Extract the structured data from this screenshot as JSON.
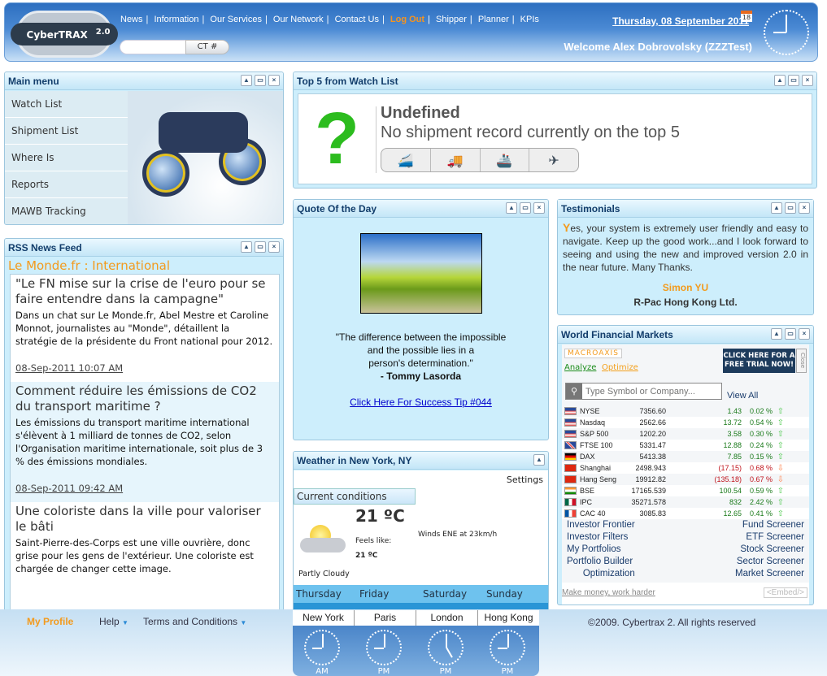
{
  "header": {
    "logo": "CyberTRAX",
    "logo_version": "2.0",
    "nav": [
      "News",
      "Information",
      "Our Services",
      "Our Network",
      "Contact Us",
      "Log Out",
      "Shipper",
      "Planner",
      "KPIs"
    ],
    "ct_button": "CT #",
    "ct_value": "",
    "date": "Thursday, 08 September 2011",
    "calendar_day": "18",
    "welcome": "Welcome Alex Dobrovolsky (ZZZTest)"
  },
  "main_menu": {
    "title": "Main menu",
    "items": [
      "Watch List",
      "Shipment List",
      "Where Is",
      "Reports",
      "MAWB Tracking"
    ]
  },
  "rss": {
    "title": "RSS News Feed",
    "source": "Le Monde.fr : International",
    "items": [
      {
        "title": "\"Le FN mise sur la crise de l'euro pour se faire entendre dans la campagne\"",
        "desc": "Dans un chat sur Le Monde.fr, Abel Mestre et Caroline Monnot, journalistes au \"Monde\", détaillent la stratégie de la présidente du Front national pour 2012.",
        "date": "08-Sep-2011 10:07 AM"
      },
      {
        "title": "Comment réduire les émissions de CO2 du transport maritime ?",
        "desc": "Les émissions du transport maritime international s'élèvent à 1 milliard de tonnes de CO2, selon l'Organisation maritime internationale, soit plus de 3 % des émissions mondiales.",
        "date": "08-Sep-2011 09:42 AM"
      },
      {
        "title": "Une coloriste dans la ville pour valoriser le bâti",
        "desc": "Saint-Pierre-des-Corps est une ville ouvrière, donc grise pour les gens de l'extérieur. Une coloriste est chargée de changer cette image.",
        "date": ""
      }
    ]
  },
  "top5": {
    "title": "Top 5 from Watch List",
    "status": "Undefined",
    "message": "No shipment record currently on the top 5",
    "modes": [
      "rail-icon",
      "truck-icon",
      "ship-icon",
      "plane-icon"
    ]
  },
  "quote": {
    "title": "Quote Of the Day",
    "lines": [
      "\"The difference between the impossible",
      "and the possible lies in a",
      "person's determination.\""
    ],
    "author": "- Tommy Lasorda",
    "link": "Click Here For Success Tip #044"
  },
  "testimonials": {
    "title": "Testimonials",
    "first_letter": "Y",
    "text": "es, your system is extremely user friendly and easy to navigate. Keep up the good work...and I look forward to seeing and using the new and improved version 2.0 in the near future. Many Thanks.",
    "name": "Simon YU",
    "company": "R-Pac Hong Kong Ltd."
  },
  "weather": {
    "title": "Weather in New York, NY",
    "settings": "Settings",
    "current_label": "Current conditions",
    "temp": "21 ºC",
    "feels_label": "Feels like:",
    "feels": "21 ºC",
    "wind": "Winds ENE at 23km/h",
    "condition": "Partly Cloudy",
    "days": [
      "Thursday",
      "Friday",
      "Saturday",
      "Sunday"
    ]
  },
  "markets": {
    "title": "World Financial Markets",
    "brand": "MACROAXIS",
    "analyze": "Analyze",
    "optimize": "Optimize",
    "trial": "CLICK HERE FOR A FREE TRIAL NOW!",
    "close": "Close",
    "search_placeholder": "Type Symbol or Company...",
    "view_all": "View All",
    "rows": [
      {
        "name": "NYSE",
        "value": "7356.60",
        "change": "1.43",
        "pct": "0.02 %",
        "dir": "up",
        "flag": "us"
      },
      {
        "name": "Nasdaq",
        "value": "2562.66",
        "change": "13.72",
        "pct": "0.54 %",
        "dir": "up",
        "flag": "us"
      },
      {
        "name": "S&P 500",
        "value": "1202.20",
        "change": "3.58",
        "pct": "0.30 %",
        "dir": "up",
        "flag": "us"
      },
      {
        "name": "FTSE 100",
        "value": "5331.47",
        "change": "12.88",
        "pct": "0.24 %",
        "dir": "up",
        "flag": "uk"
      },
      {
        "name": "DAX",
        "value": "5413.38",
        "change": "7.85",
        "pct": "0.15 %",
        "dir": "up",
        "flag": "de"
      },
      {
        "name": "Shanghai",
        "value": "2498.943",
        "change": "(17.15)",
        "pct": "0.68 %",
        "dir": "down",
        "flag": "cn"
      },
      {
        "name": "Hang Seng",
        "value": "19912.82",
        "change": "(135.18)",
        "pct": "0.67 %",
        "dir": "down",
        "flag": "hk"
      },
      {
        "name": "BSE",
        "value": "17165.539",
        "change": "100.54",
        "pct": "0.59 %",
        "dir": "up",
        "flag": "in"
      },
      {
        "name": "IPC",
        "value": "35271.578",
        "change": "832",
        "pct": "2.42 %",
        "dir": "up",
        "flag": "mx"
      },
      {
        "name": "CAC 40",
        "value": "3085.83",
        "change": "12.65",
        "pct": "0.41 %",
        "dir": "up",
        "flag": "fr"
      }
    ],
    "links_left": [
      "Investor Frontier",
      "Investor Filters",
      "My Portfolios",
      "Portfolio Builder",
      "Optimization"
    ],
    "links_right": [
      "Fund Screener",
      "ETF Screener",
      "Stock Screener",
      "Sector Screener",
      "Market Screener"
    ],
    "tagline": "Make money, work harder",
    "embed": "<Embed/>"
  },
  "footer": {
    "my_profile": "My Profile",
    "help": "Help",
    "terms": "Terms and Conditions",
    "copyright": "©2009. Cybertrax 2. All rights reserved",
    "clocks": [
      {
        "city": "New York",
        "ampm": "AM"
      },
      {
        "city": "Paris",
        "ampm": "PM"
      },
      {
        "city": "London",
        "ampm": "PM"
      },
      {
        "city": "Hong Kong",
        "ampm": "PM"
      }
    ]
  },
  "colors": {
    "accent": "#f39a1c",
    "panel_bg": "#cdeefc",
    "header_blue": "#2d6fc0",
    "up": "#1a7a1a",
    "down": "#c0141c"
  }
}
